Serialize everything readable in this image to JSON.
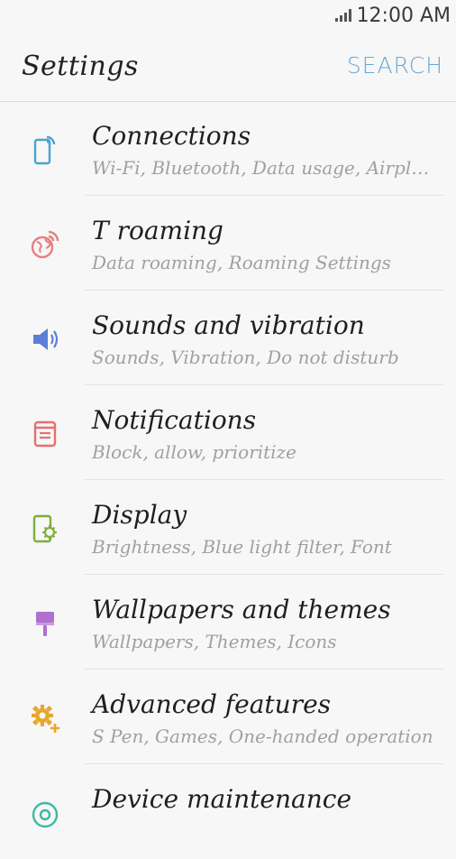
{
  "status": {
    "time": "12:00 AM"
  },
  "header": {
    "title": "Settings",
    "search_label": "SEARCH"
  },
  "items": [
    {
      "title": "Connections",
      "subtitle": "Wi-Fi, Bluetooth, Data usage, Airplane...",
      "icon": "connections-icon",
      "color": "#4aa3d8"
    },
    {
      "title": "T roaming",
      "subtitle": "Data roaming, Roaming Settings",
      "icon": "roaming-globe-icon",
      "color": "#e87f7f"
    },
    {
      "title": "Sounds and vibration",
      "subtitle": "Sounds, Vibration,  Do not disturb",
      "icon": "speaker-icon",
      "color": "#5b7fd6"
    },
    {
      "title": "Notifications",
      "subtitle": "Block, allow, prioritize",
      "icon": "notifications-icon",
      "color": "#e86f6f"
    },
    {
      "title": "Display",
      "subtitle": "Brightness, Blue light filter, Font",
      "icon": "display-icon",
      "color": "#7fae3c"
    },
    {
      "title": "Wallpapers and themes",
      "subtitle": "Wallpapers, Themes, Icons",
      "icon": "paint-brush-icon",
      "color": "#b16fd0"
    },
    {
      "title": "Advanced features",
      "subtitle": "S Pen, Games, One-handed operation",
      "icon": "gear-plus-icon",
      "color": "#e6a72e"
    },
    {
      "title": "Device maintenance",
      "subtitle": "",
      "icon": "device-maintenance-icon",
      "color": "#3fb8a0"
    }
  ]
}
